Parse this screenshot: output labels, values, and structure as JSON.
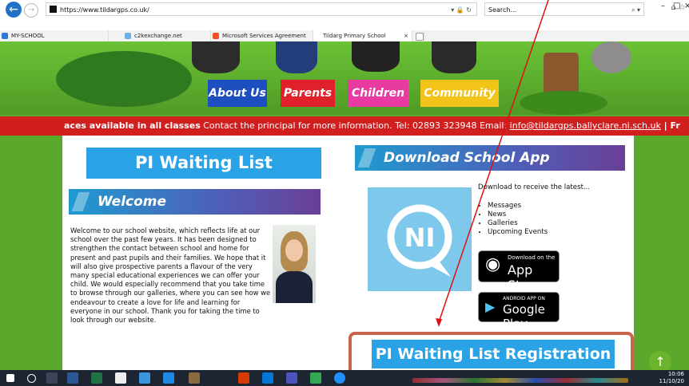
{
  "browser": {
    "url": "https://www.tildargps.co.uk/",
    "search_placeholder": "Search...",
    "tabs": [
      {
        "label": "MY-SCHOOL"
      },
      {
        "label": "c2kexchange.net"
      },
      {
        "label": "Microsoft Services Agreement"
      },
      {
        "label": "Tildarg Primary School"
      }
    ]
  },
  "nav": {
    "about": "About Us",
    "parents": "Parents",
    "children": "Children",
    "community": "Community"
  },
  "ticker": {
    "bold": "aces available in all classes",
    "text": " Contact the principal for more information. Tel: 02893 323948 Email: ",
    "email": "info@tildargps.ballyclare.ni.sch.uk",
    "tail": "  |  Fr"
  },
  "left": {
    "banner": "PI Waiting List Registration",
    "welcome_heading": "Welcome",
    "welcome_text": "Welcome to our school website, which reflects life at our school over the past few years.  It has been designed to strengthen the contact between school and home for present and past pupils and their families. We hope that it will also give prospective parents a flavour of the very many special educational experiences we can offer your child.  We would especially recommend that you take time to browse through our galleries, where you can see how we endeavour to create a love for life and learning for everyone in our school. Thank you for taking the time to look through our website."
  },
  "right": {
    "heading": "Download School App",
    "intro": "Download to receive the latest...",
    "bullets": [
      "Messages",
      "News",
      "Galleries",
      "Upcoming Events"
    ],
    "appstore_small": "Download on the",
    "appstore_big": "App Store",
    "gplay_small": "ANDROID APP ON",
    "gplay_big": "Google Play",
    "bottom_banner": "PI Waiting List Registration",
    "tile_text": "NI"
  },
  "taskbar": {
    "time": "10:06",
    "date": "11/10/20"
  },
  "colors": {
    "ticker_red": "#d11f1f",
    "banner_blue": "#2aa3e6",
    "highlight": "#c6664a",
    "nav_about": "#1e4fc1",
    "nav_parents": "#e0212b",
    "nav_children": "#e83aa0",
    "nav_community": "#f2c318"
  }
}
